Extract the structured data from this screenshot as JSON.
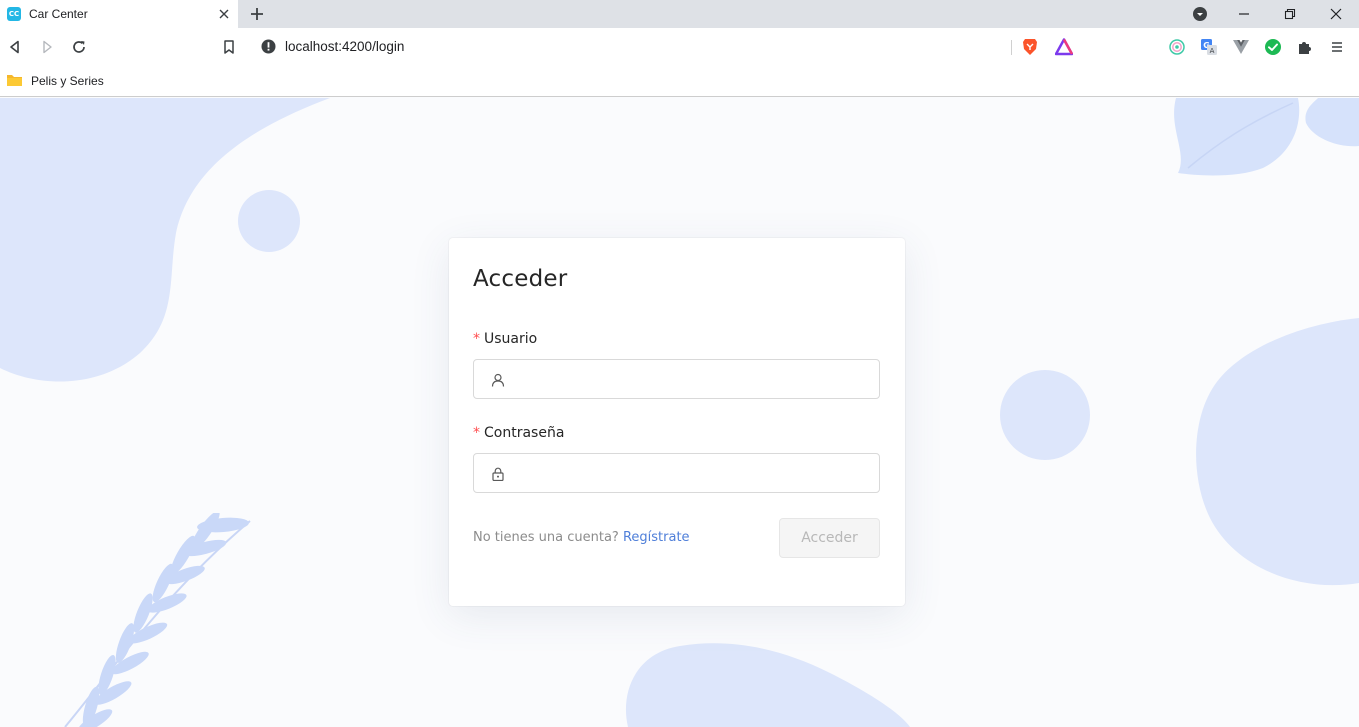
{
  "browser": {
    "tab_title": "Car Center",
    "tab_favicon_text": "CC",
    "url": "localhost:4200/login",
    "bookmark_label": "Pelis y Series"
  },
  "login": {
    "title": "Acceder",
    "username_label": "Usuario",
    "password_label": "Contraseña",
    "required_mark": "*",
    "username_value": "",
    "password_value": "",
    "signup_prompt": "No tienes una cuenta?",
    "signup_link": "Regístrate",
    "submit_label": "Acceder"
  },
  "colors": {
    "accent": "#4f7fd9",
    "required": "#ff4d4f",
    "decoration": "#dde6fb",
    "page_background": "#fafbfd"
  }
}
